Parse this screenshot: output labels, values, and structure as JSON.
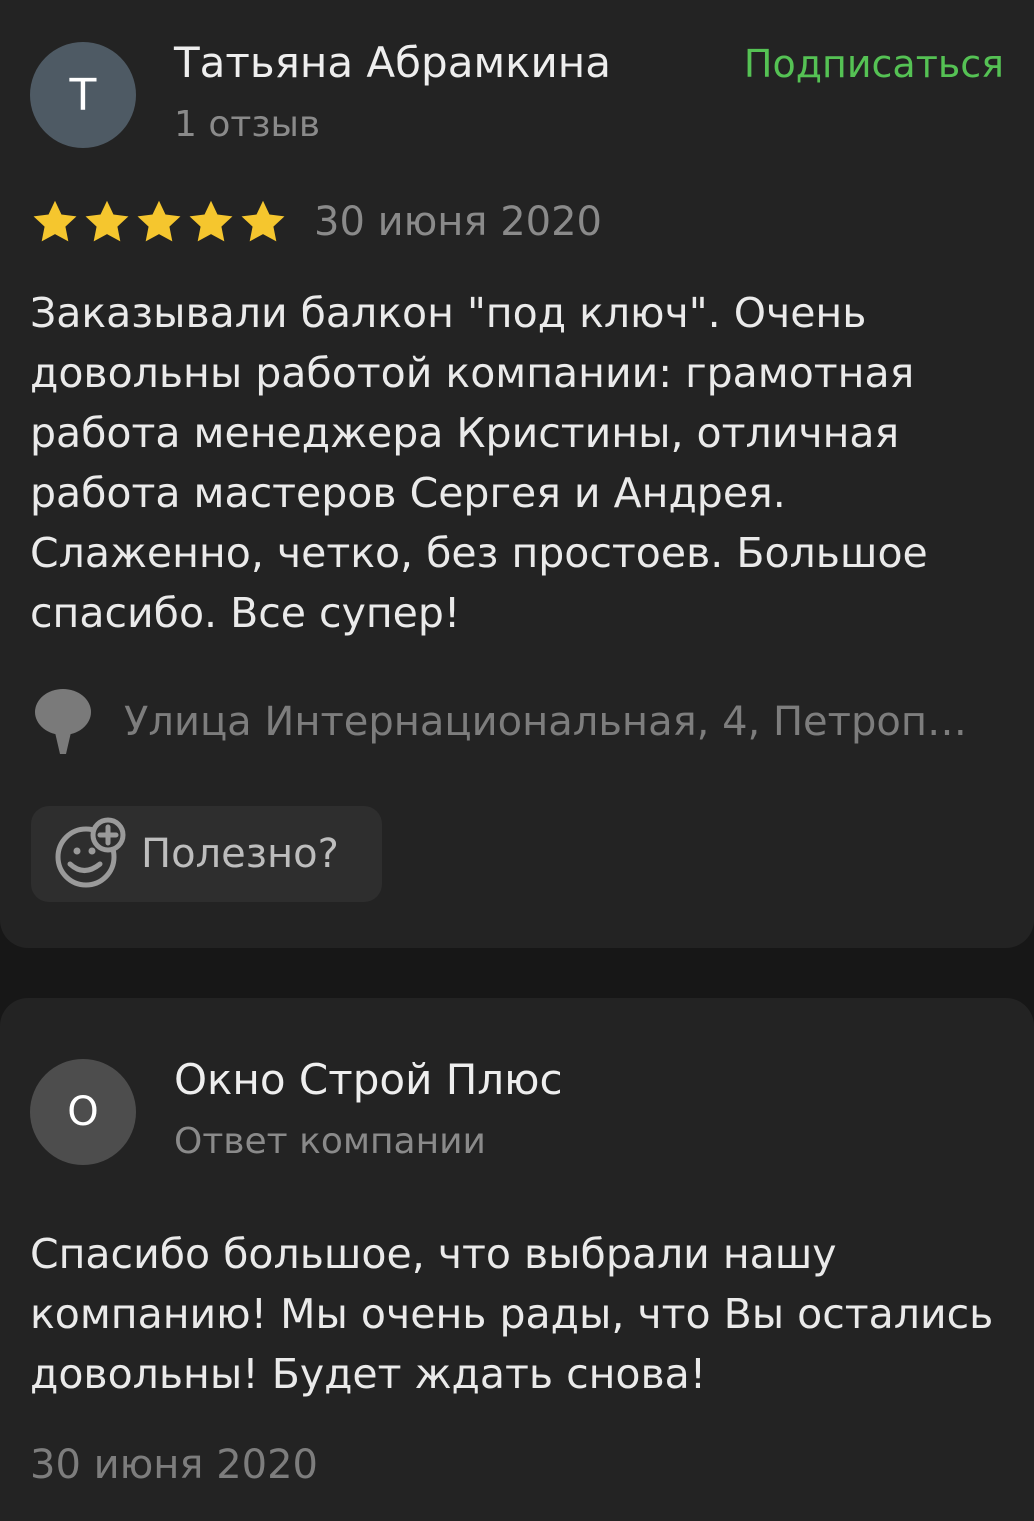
{
  "review": {
    "author": {
      "initial": "Т",
      "name": "Татьяна Абрамкина",
      "reviews_count": "1 отзыв"
    },
    "subscribe_label": "Подписаться",
    "rating": 5,
    "rating_max": 5,
    "date": "30 июня 2020",
    "text": "Заказывали балкон \"под ключ\". Очень довольны работой компании: грамотная работа менеджера Кристины, отличная работа мастеров Сергея и Андрея. Слаженно, четко, без простоев. Большое спасибо. Все супер!",
    "address": "Улица Интернациональная, 4, Петроп…",
    "useful_label": "Полезно?"
  },
  "reply": {
    "author": {
      "initial": "О",
      "name": "Окно Строй Плюс",
      "subtitle": "Ответ компании"
    },
    "text": "Спасибо большое, что выбрали нашу компанию! Мы очень рады, что Вы остались довольны! Будет ждать снова!",
    "date": "30 июня 2020"
  },
  "colors": {
    "background": "#171717",
    "card": "#232323",
    "accent_green": "#55c254",
    "star": "#f5c62e",
    "muted_text": "#8a8a8a"
  },
  "icons": {
    "star": "star-icon",
    "pin": "map-pin-icon",
    "useful": "smile-plus-icon"
  }
}
